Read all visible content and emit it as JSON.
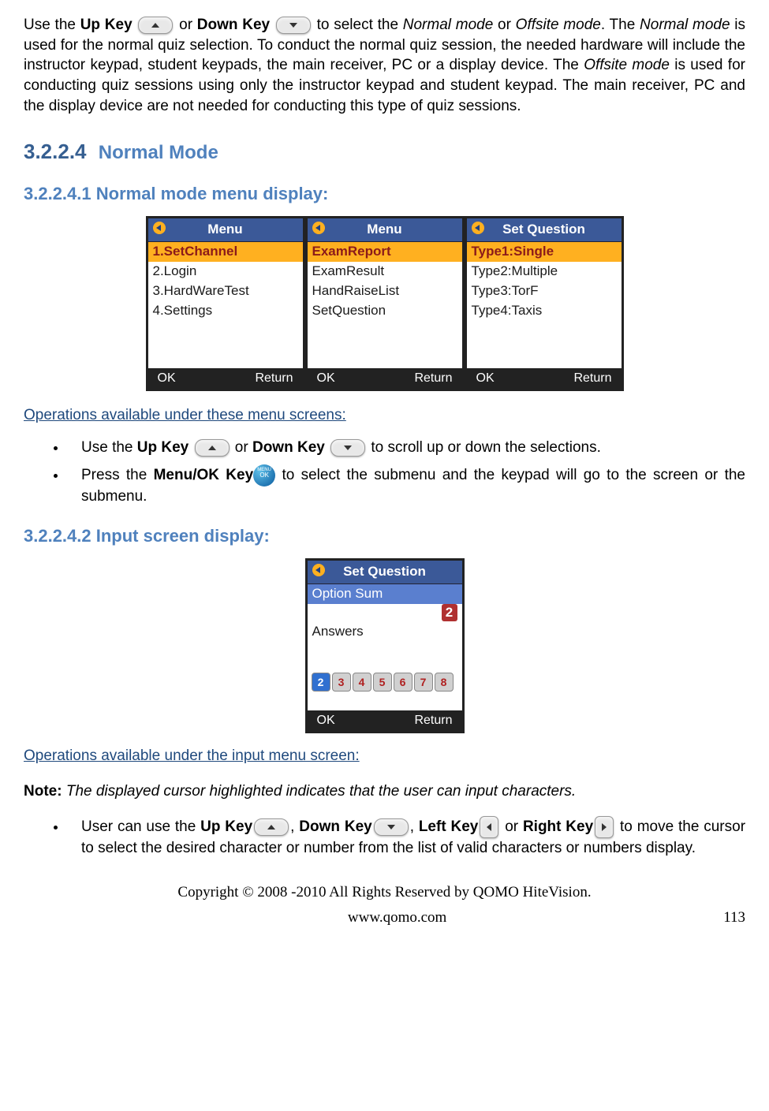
{
  "intro": {
    "prefix": "Use the ",
    "upkey": "Up Key",
    "or": " or ",
    "downkey": "Down Key",
    "mid1": " to select the ",
    "normal_i": "Normal mode",
    "or2": " or ",
    "offsite_i": "Offsite mode",
    "rest": ". The Normal mode is used for the normal quiz selection. To conduct the normal quiz session, the needed hardware will include the instructor keypad, student keypads, the main receiver, PC or a display device. The Offsite mode is used for conducting quiz sessions using only the instructor keypad and student keypad. The main receiver, PC and the display device are not needed for conducting this type of quiz sessions."
  },
  "h1": {
    "num": "3.2.2.4",
    "title": "Normal Mode"
  },
  "h2": "3.2.2.4.1  Normal mode menu display:",
  "screens": [
    {
      "title": "Menu",
      "items": [
        "1.SetChannel",
        "2.Login",
        "3.HardWareTest",
        "4.Settings"
      ],
      "selected": 0,
      "okLabel": "OK",
      "retLabel": "Return"
    },
    {
      "title": "Menu",
      "items": [
        "ExamReport",
        "ExamResult",
        "HandRaiseList",
        "SetQuestion"
      ],
      "selected": 0,
      "okLabel": "OK",
      "retLabel": "Return"
    },
    {
      "title": "Set Question",
      "items": [
        "Type1:Single",
        "Type2:Multiple",
        "Type3:TorF",
        "Type4:Taxis"
      ],
      "selected": 0,
      "okLabel": "OK",
      "retLabel": "Return"
    }
  ],
  "ops1_title": "Operations available under these menu screens:",
  "ops1": {
    "b1_pre": "Use the ",
    "b1_up": "Up Key",
    "b1_or": " or ",
    "b1_down": "Down Key",
    "b1_post": " to scroll up or down the selections.",
    "b2_pre": "Press the ",
    "b2_key": "Menu/OK Key",
    "b2_post": " to select the submenu and the keypad will go to the screen or the submenu."
  },
  "h3": "3.2.2.4.2  Input screen display:",
  "input_screen": {
    "title": "Set Question",
    "row1": "Option  Sum",
    "row2": "Answers",
    "nums": [
      "2",
      "3",
      "4",
      "5",
      "6",
      "7",
      "8"
    ],
    "cursor": "2",
    "okLabel": "OK",
    "retLabel": "Return"
  },
  "ops2_title": "Operations available under the input menu screen:",
  "note_label": "Note:",
  "note_text": " The displayed cursor highlighted indicates that the user can input characters.",
  "ops2": {
    "pre": "User can use the ",
    "up": "Up Key",
    "c1": ", ",
    "down": "Down Key",
    "c2": ", ",
    "left": "Left Key",
    "or": " or ",
    "right": "Right Key",
    "post": " to move the cursor to select the desired character or number from the list of valid characters or numbers display."
  },
  "footer": {
    "copyright": "Copyright © 2008 -2010 All Rights Reserved by QOMO HiteVision.",
    "url": "www.qomo.com",
    "page": "113"
  }
}
